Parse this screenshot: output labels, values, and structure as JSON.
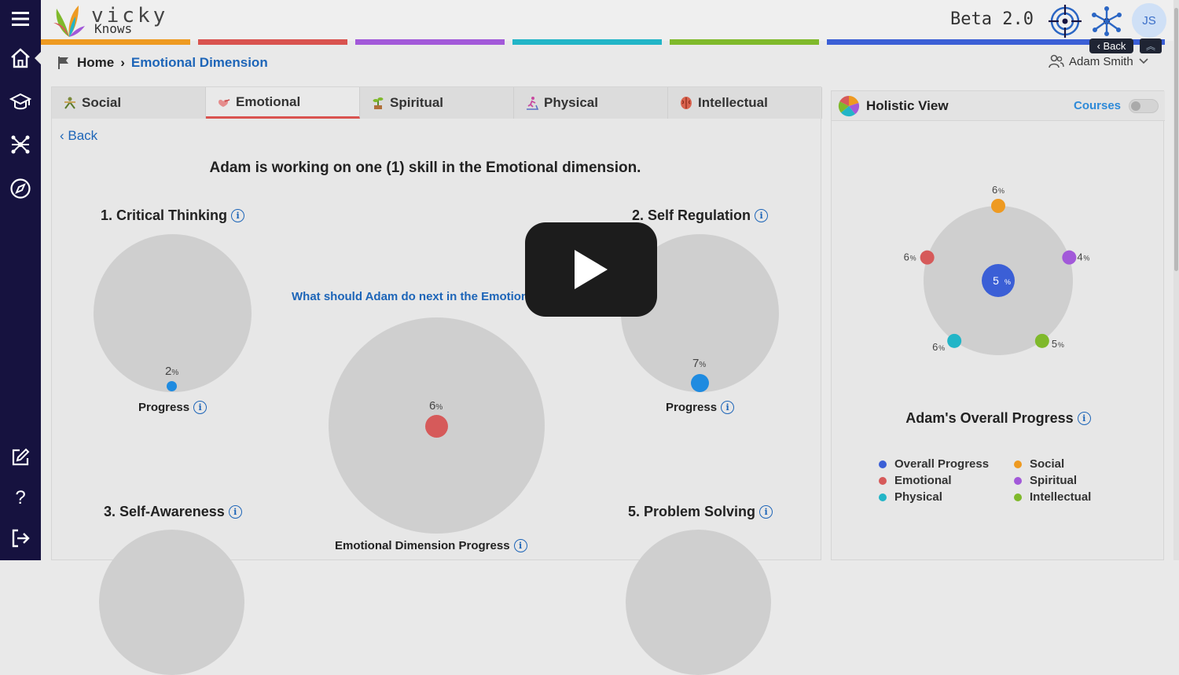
{
  "brand": {
    "name_top": "vicky",
    "name_bottom": "Knows"
  },
  "header": {
    "version": "Beta 2.0",
    "avatar_initials": "JS",
    "back_label": "Back",
    "user_name": "Adam Smith"
  },
  "brand_stripe_colors": [
    "#ee9a21",
    "#d9534f",
    "#a259d9",
    "#22b5c7",
    "#7fb92b",
    "#3b5fd6"
  ],
  "breadcrumb": {
    "home": "Home",
    "current": "Emotional Dimension"
  },
  "tabs": [
    {
      "label": "Social",
      "icon": "social-icon"
    },
    {
      "label": "Emotional",
      "icon": "emotional-icon"
    },
    {
      "label": "Spiritual",
      "icon": "spiritual-icon"
    },
    {
      "label": "Physical",
      "icon": "physical-icon"
    },
    {
      "label": "Intellectual",
      "icon": "intellectual-icon"
    }
  ],
  "main": {
    "back_label": "Back",
    "headline": "Adam is working on one (1) skill in the Emotional dimension.",
    "next_question": "What should Adam do next in the Emotional d",
    "skills": [
      {
        "title": "1. Critical Thinking",
        "progress_value": "2",
        "progress_label": "Progress",
        "dot_color": "#1f8be0"
      },
      {
        "title": "2. Self Regulation",
        "progress_value": "7",
        "progress_label": "Progress",
        "dot_color": "#1f8be0"
      },
      {
        "title": "3. Self-Awareness"
      },
      {
        "title": "5. Problem Solving"
      }
    ],
    "dimension": {
      "progress_value": "6",
      "label": "Emotional Dimension Progress",
      "dot_color": "#d65a5a"
    },
    "percent_sign": "%"
  },
  "holistic": {
    "title": "Holistic View",
    "courses_label": "Courses",
    "courses_toggle_on": false,
    "center_value": "5",
    "points": [
      {
        "name": "Social",
        "value": "6",
        "color": "#ee9a21"
      },
      {
        "name": "Spiritual",
        "value": "4",
        "color": "#a259d9"
      },
      {
        "name": "Intellectual",
        "value": "5",
        "color": "#7fb92b"
      },
      {
        "name": "Physical",
        "value": "6",
        "color": "#22b5c7"
      },
      {
        "name": "Emotional",
        "value": "6",
        "color": "#d65a5a"
      }
    ],
    "overall_title": "Adam's Overall Progress",
    "legend": [
      {
        "label": "Overall Progress",
        "color": "#3b5fd6"
      },
      {
        "label": "Social",
        "color": "#ee9a21"
      },
      {
        "label": "Emotional",
        "color": "#d65a5a"
      },
      {
        "label": "Spiritual",
        "color": "#a259d9"
      },
      {
        "label": "Physical",
        "color": "#22b5c7"
      },
      {
        "label": "Intellectual",
        "color": "#7fb92b"
      }
    ]
  },
  "video_overlay": {
    "icon": "play-icon"
  },
  "sidebar": {
    "items": [
      {
        "icon": "menu-icon"
      },
      {
        "icon": "home-icon"
      },
      {
        "icon": "graduation-cap-icon"
      },
      {
        "icon": "network-icon"
      },
      {
        "icon": "compass-icon"
      },
      {
        "icon": "edit-icon"
      },
      {
        "icon": "help-icon"
      },
      {
        "icon": "logout-icon"
      }
    ]
  }
}
